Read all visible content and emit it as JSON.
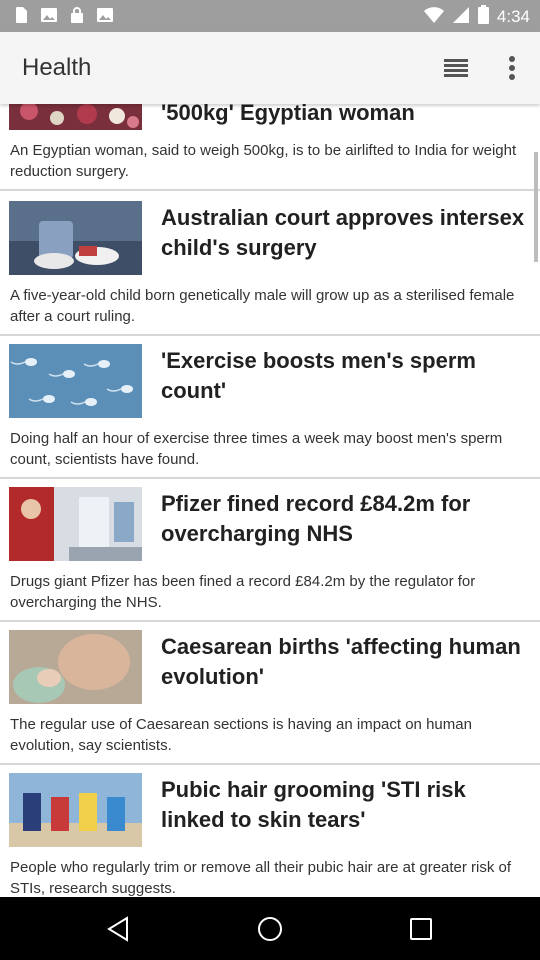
{
  "status": {
    "time": "4:34"
  },
  "app_bar": {
    "title": "Health"
  },
  "articles": [
    {
      "title": "'500kg' Egyptian woman",
      "summary": "An Egyptian woman, said to weigh 500kg, is to be airlifted to India for weight reduction surgery."
    },
    {
      "title": "Australian court approves intersex child's surgery",
      "summary": "A five-year-old child born genetically male will grow up as a sterilised female after a court ruling."
    },
    {
      "title": "'Exercise boosts men's sperm count'",
      "summary": "Doing half an hour of exercise three times a week may boost men's sperm count, scientists have found."
    },
    {
      "title": "Pfizer fined record £84.2m for overcharging NHS",
      "summary": "Drugs giant Pfizer has been fined a record £84.2m by the regulator for overcharging the NHS."
    },
    {
      "title": "Caesarean births 'affecting human evolution'",
      "summary": "The regular use of Caesarean sections is having an impact on human evolution, say scientists."
    },
    {
      "title": "Pubic hair grooming 'STI risk linked to skin tears'",
      "summary": "People who regularly trim or remove all their pubic hair are at greater risk of STIs, research suggests."
    }
  ],
  "icons": [
    "sim-card-icon",
    "image-icon",
    "lock-icon",
    "image-icon",
    "wifi-icon",
    "signal-icon",
    "battery-icon",
    "list-menu-icon",
    "more-vert-icon",
    "back-icon",
    "home-icon",
    "recents-icon"
  ],
  "colors": {
    "status_bar": "#9e9e9e",
    "app_bar": "#f5f5f5",
    "nav_bar": "#000000",
    "divider": "#d6d6d6"
  }
}
